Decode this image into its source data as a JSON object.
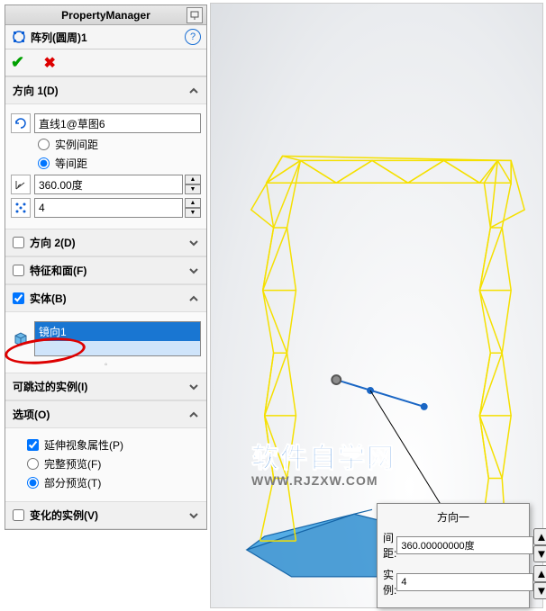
{
  "header": {
    "title": "PropertyManager"
  },
  "feature": {
    "name": "阵列(圆周)1"
  },
  "dir1": {
    "title": "方向 1(D)",
    "axis_value": "直线1@草图6",
    "radio_instance": "实例间距",
    "radio_equal": "等间距",
    "angle_value": "360.00度",
    "count_value": "4"
  },
  "dir2": {
    "title": "方向 2(D)"
  },
  "features_faces": {
    "title": "特征和面(F)"
  },
  "bodies": {
    "title": "实体(B)",
    "selected": "镜向1"
  },
  "skippable": {
    "title": "可跳过的实例(I)"
  },
  "options": {
    "title": "选项(O)",
    "extend": "延伸视象属性(P)",
    "full_preview": "完整预览(F)",
    "partial_preview": "部分预览(T)"
  },
  "varied": {
    "title": "变化的实例(V)"
  },
  "popup": {
    "title": "方向一",
    "spacing_label": "间距:",
    "spacing_value": "360.00000000度",
    "count_label": "实例:",
    "count_value": "4"
  },
  "watermark": {
    "cn": "软件自学网",
    "url": "WWW.RJZXW.COM"
  }
}
